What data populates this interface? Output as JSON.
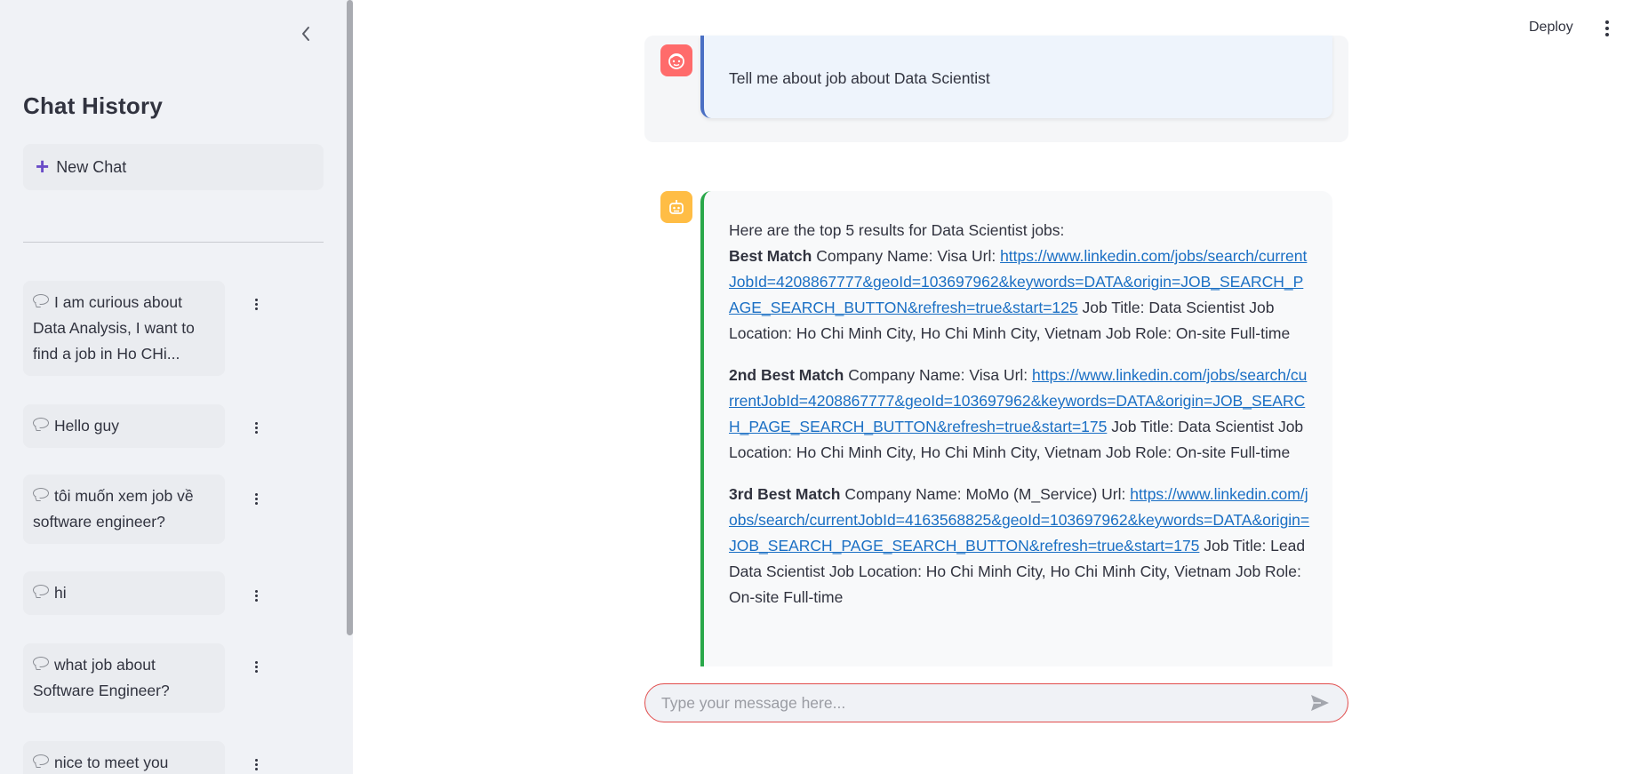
{
  "header": {
    "deploy_label": "Deploy"
  },
  "sidebar": {
    "title": "Chat History",
    "new_chat_label": "New Chat",
    "history": [
      "I am curious about Data Analysis, I want to find a job in Ho CHi...",
      "Hello guy",
      "tôi muốn xem job về software engineer?",
      "hi",
      "what job about Software Engineer?",
      "nice to meet you"
    ]
  },
  "chat": {
    "user_message": "Tell me about job about Data Scientist",
    "bot": {
      "intro": "Here are the top 5 results for Data Scientist jobs:",
      "results": [
        {
          "rank": "Best Match",
          "pre": " Company Name: Visa Url: ",
          "url": "https://www.linkedin.com/jobs/search/currentJobId=4208867777&geoId=103697962&keywords=DATA&origin=JOB_SEARCH_PAGE_SEARCH_BUTTON&refresh=true&start=125",
          "post": " Job Title: Data Scientist Job Location: Ho Chi Minh City, Ho Chi Minh City, Vietnam Job Role: On-site Full-time"
        },
        {
          "rank": "2nd Best Match",
          "pre": " Company Name: Visa Url: ",
          "url": "https://www.linkedin.com/jobs/search/currentJobId=4208867777&geoId=103697962&keywords=DATA&origin=JOB_SEARCH_PAGE_SEARCH_BUTTON&refresh=true&start=175",
          "post": " Job Title: Data Scientist Job Location: Ho Chi Minh City, Ho Chi Minh City, Vietnam Job Role: On-site Full-time"
        },
        {
          "rank": "3rd Best Match",
          "pre": " Company Name: MoMo (M_Service) Url: ",
          "url": "https://www.linkedin.com/jobs/search/currentJobId=4163568825&geoId=103697962&keywords=DATA&origin=JOB_SEARCH_PAGE_SEARCH_BUTTON&refresh=true&start=175",
          "post": " Job Title: Lead Data Scientist Job Location: Ho Chi Minh City, Ho Chi Minh City, Vietnam Job Role: On-site Full-time"
        }
      ]
    },
    "input": {
      "placeholder": "Type your message here...",
      "value": ""
    }
  },
  "colors": {
    "user_avatar": "#ff6b6b",
    "bot_avatar": "#ffbd45",
    "user_accent": "#4a6fc4",
    "bot_accent": "#2aa84a",
    "link": "#1a6fc4",
    "input_border": "#e14b4b"
  },
  "icons": {
    "collapse": "chevron-left-icon",
    "new_chat": "plus-icon",
    "history_item": "chat-bubble-icon",
    "item_menu": "kebab-menu-icon",
    "main_menu": "kebab-menu-icon",
    "user_avatar": "user-face-icon",
    "bot_avatar": "robot-icon",
    "send": "send-icon"
  }
}
